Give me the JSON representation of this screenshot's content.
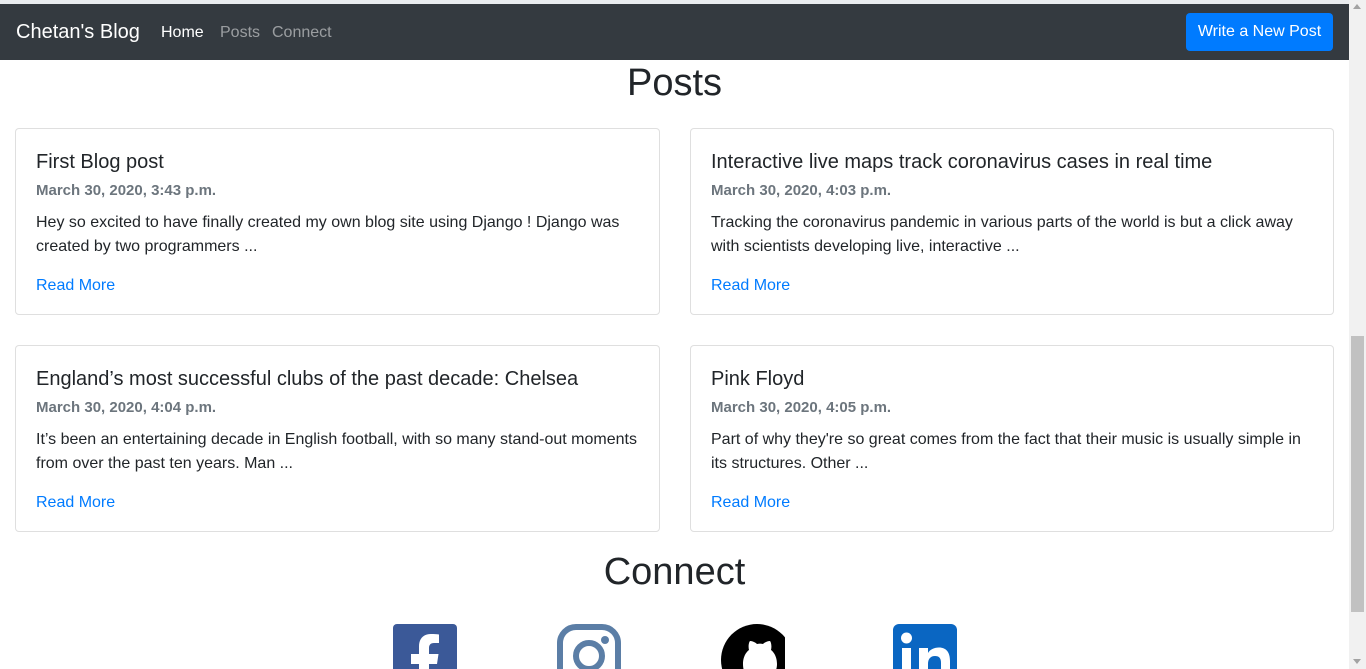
{
  "navbar": {
    "brand": "Chetan's Blog",
    "links": [
      {
        "label": "Home"
      },
      {
        "label": "Posts"
      },
      {
        "label": "Connect"
      }
    ],
    "cta_label": "Write a New Post"
  },
  "posts_section": {
    "title": "Posts",
    "posts": [
      {
        "title": "First Blog post",
        "date": "March 30, 2020, 3:43 p.m.",
        "excerpt": "Hey so excited to have finally created my own blog site using Django ! Django was created by two programmers ...",
        "link_label": "Read More"
      },
      {
        "title": "Interactive live maps track coronavirus cases in real time",
        "date": "March 30, 2020, 4:03 p.m.",
        "excerpt": "Tracking the coronavirus pandemic in various parts of the world is but a click away with scientists developing live, interactive ...",
        "link_label": "Read More"
      },
      {
        "title": "England’s most successful clubs of the past decade: Chelsea",
        "date": "March 30, 2020, 4:04 p.m.",
        "excerpt": "It’s been an entertaining decade in English football, with so many stand-out moments from over the past ten years. Man ...",
        "link_label": "Read More"
      },
      {
        "title": "Pink Floyd",
        "date": "March 30, 2020, 4:05 p.m.",
        "excerpt": "Part of why they're so great comes from the fact that their music is usually simple in its structures. Other ...",
        "link_label": "Read More"
      }
    ]
  },
  "connect_section": {
    "title": "Connect",
    "icons": [
      "facebook-icon",
      "instagram-icon",
      "github-icon",
      "linkedin-icon"
    ]
  },
  "colors": {
    "navbar_bg": "#343a40",
    "primary": "#007bff",
    "muted": "#6c757d"
  }
}
